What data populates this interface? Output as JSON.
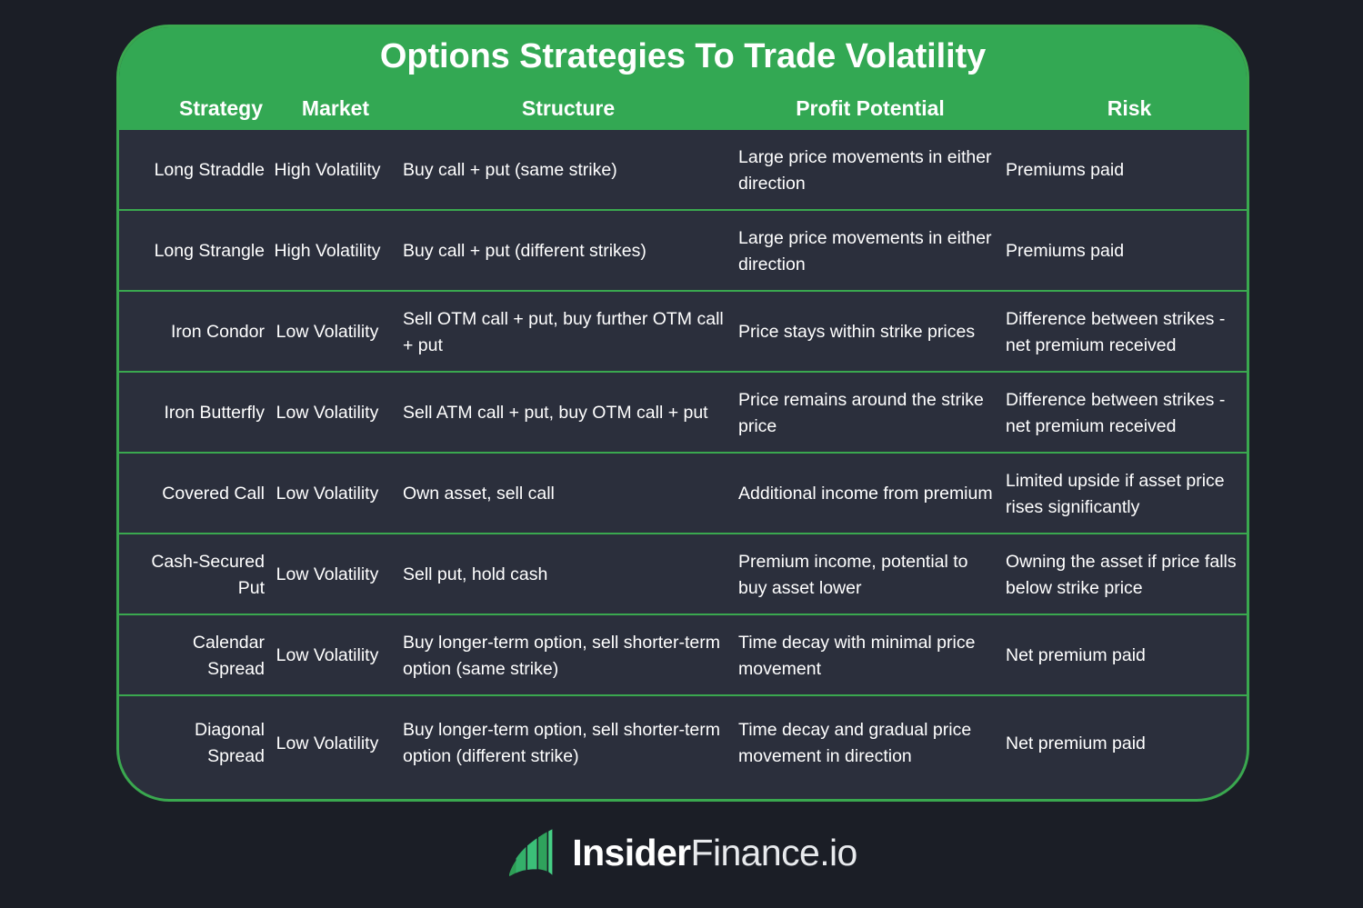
{
  "colors": {
    "page_background": "#1b1e26",
    "accent_green": "#33a853",
    "border_green": "#3aa84f",
    "table_background": "#2b2f3c",
    "text": "#ffffff"
  },
  "header": {
    "title": "Options Strategies To Trade Volatility",
    "columns": [
      "Strategy",
      "Market",
      "Structure",
      "Profit Potential",
      "Risk"
    ]
  },
  "table": {
    "rows": [
      {
        "strategy": "Long Straddle",
        "market": "High Volatility",
        "structure": "Buy call + put (same strike)",
        "profit": "Large price movements in either direction",
        "risk": "Premiums paid"
      },
      {
        "strategy": "Long Strangle",
        "market": "High Volatility",
        "structure": "Buy call + put (different strikes)",
        "profit": "Large price movements in either direction",
        "risk": "Premiums paid"
      },
      {
        "strategy": "Iron Condor",
        "market": "Low Volatility",
        "structure": "Sell OTM call + put, buy further OTM call + put",
        "profit": "Price stays within strike prices",
        "risk": "Difference between strikes - net premium received"
      },
      {
        "strategy": "Iron Butterfly",
        "market": "Low Volatility",
        "structure": "Sell ATM call + put, buy OTM call + put",
        "profit": "Price remains around the strike price",
        "risk": "Difference between strikes - net premium received"
      },
      {
        "strategy": "Covered Call",
        "market": "Low Volatility",
        "structure": "Own asset, sell call",
        "profit": "Additional income from premium",
        "risk": "Limited upside if asset price rises significantly"
      },
      {
        "strategy": "Cash-Secured Put",
        "market": "Low Volatility",
        "structure": "Sell put, hold cash",
        "profit": "Premium income, potential to buy asset lower",
        "risk": "Owning the asset if price falls below strike price"
      },
      {
        "strategy": "Calendar Spread",
        "market": "Low Volatility",
        "structure": "Buy longer-term option, sell shorter-term option (same strike)",
        "profit": "Time decay with minimal price movement",
        "risk": "Net premium paid"
      },
      {
        "strategy": "Diagonal Spread",
        "market": "Low Volatility",
        "structure": "Buy longer-term option, sell shorter-term option (different strike)",
        "profit": "Time decay and gradual price movement in direction",
        "risk": "Net premium paid"
      }
    ]
  },
  "footer": {
    "logo_icon": "bar-chart-logo-icon",
    "brand_bold": "Insider",
    "brand_light": "Finance.io"
  }
}
